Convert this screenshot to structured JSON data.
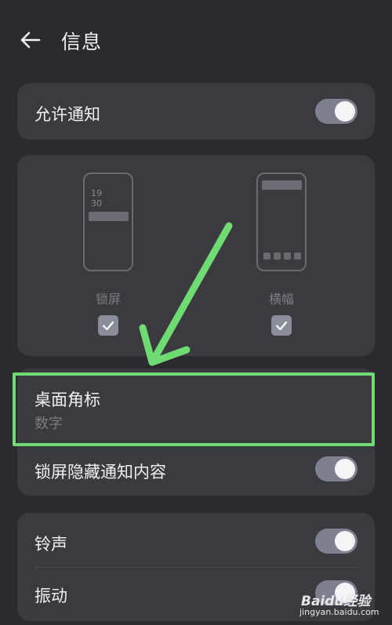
{
  "header": {
    "title": "信息",
    "back_icon": "arrow-left-icon"
  },
  "allow_notifications": {
    "label": "允许通知",
    "enabled": true
  },
  "preview": {
    "lock_screen": {
      "time_line1": "19",
      "time_line2": "30",
      "label": "锁屏",
      "checked": true
    },
    "banner": {
      "label": "横幅",
      "checked": true
    }
  },
  "badge": {
    "label": "桌面角标",
    "value": "数字"
  },
  "hide_content": {
    "label": "锁屏隐藏通知内容",
    "enabled": true
  },
  "sound": {
    "ringtone": {
      "label": "铃声",
      "enabled": true
    },
    "vibration": {
      "label": "振动",
      "enabled": true
    }
  },
  "watermark": {
    "brand": "Baidu经验",
    "url": "jingyan.baidu.com"
  },
  "colors": {
    "background": "#2b2a2e",
    "card": "#3b3a3f",
    "highlight": "#6fdc73",
    "toggle_on": "#7e8090"
  }
}
